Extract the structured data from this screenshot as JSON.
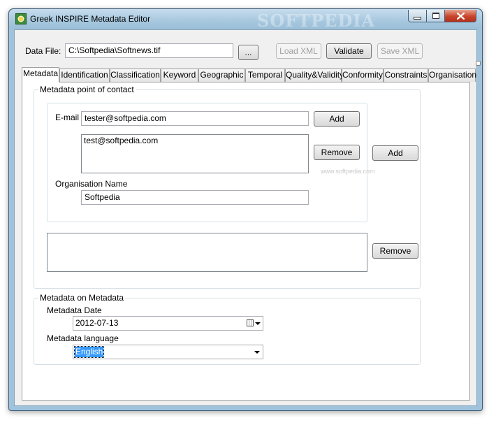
{
  "window": {
    "title": "Greek INSPIRE Metadata Editor",
    "watermark": "SOFTPEDIA"
  },
  "datafile": {
    "label": "Data File:",
    "value": "C:\\Softpedia\\Softnews.tif",
    "browse_label": "...",
    "load_label": "Load XML",
    "validate_label": "Validate",
    "save_label": "Save XML"
  },
  "tabs": [
    {
      "label": "Metadata",
      "active": true
    },
    {
      "label": "Identification"
    },
    {
      "label": "Classification"
    },
    {
      "label": "Keyword"
    },
    {
      "label": "Geographic"
    },
    {
      "label": "Temporal"
    },
    {
      "label": "Quality&Validity"
    },
    {
      "label": "Conformity"
    },
    {
      "label": "Constraints"
    },
    {
      "label": "Organisation"
    }
  ],
  "contact": {
    "group_title": "Metadata point of contact",
    "email_label": "E-mail",
    "email_value": "tester@softpedia.com",
    "email_add_label": "Add",
    "email_list": [
      "test@softpedia.com"
    ],
    "email_remove_label": "Remove",
    "org_label": "Organisation Name",
    "org_value": "Softpedia",
    "contact_add_label": "Add",
    "contact_remove_label": "Remove",
    "watermark_small": "www.softpedia.com"
  },
  "meta": {
    "group_title": "Metadata on Metadata",
    "date_label": "Metadata Date",
    "date_value": "2012-07-13",
    "language_label": "Metadata language",
    "language_value": "English"
  }
}
